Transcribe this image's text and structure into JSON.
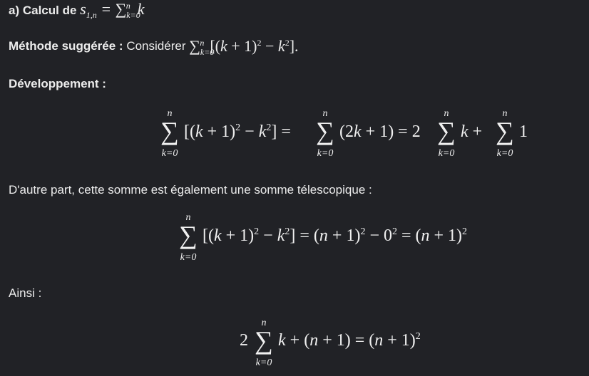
{
  "heading": {
    "prefix": "a) Calcul de",
    "formula": "s1,n = ∑k=0n k"
  },
  "method": {
    "label": "Méthode suggérée :",
    "text": "Considérer",
    "formula": "∑k=0n[(k+1)² − k²]."
  },
  "development": {
    "label": "Développement :"
  },
  "eq1": {
    "sum_upper": "n",
    "sum_lower": "k=0",
    "part1": "[(k + 1)² − k²] =",
    "part2": "(2k + 1) = 2",
    "part3": "k +",
    "part4": "1"
  },
  "telescopic": {
    "text": "D'autre part, cette somme est également une somme télescopique :"
  },
  "eq2": {
    "sum_upper": "n",
    "sum_lower": "k=0",
    "text": "[(k + 1)² − k²] = (n + 1)² − 0² = (n + 1)²"
  },
  "ainsi": {
    "text": "Ainsi :"
  },
  "eq3": {
    "prefix": "2",
    "sum_upper": "n",
    "sum_lower": "k=0",
    "text": "k + (n + 1) = (n + 1)²"
  }
}
